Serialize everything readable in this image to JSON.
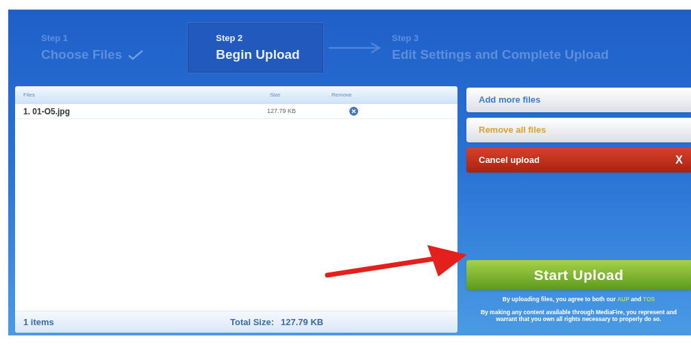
{
  "steps": [
    {
      "label": "Step 1",
      "title": "Choose Files",
      "done": true,
      "selected": false
    },
    {
      "label": "Step 2",
      "title": "Begin Upload",
      "done": false,
      "selected": true
    },
    {
      "label": "Step 3",
      "title": "Edit Settings and Complete Upload",
      "done": false,
      "selected": false
    }
  ],
  "files": {
    "columns": [
      "Files",
      "Size",
      "Remove"
    ],
    "rows": [
      {
        "name": "1. 01-O5.jpg",
        "size": "127.79 KB"
      }
    ],
    "footer": {
      "count": "1 items",
      "total_label": "Total Size:",
      "total": "127.79 KB"
    }
  },
  "actions": [
    {
      "label": "Add more files",
      "kind": "add"
    },
    {
      "label": "Remove all files",
      "kind": "remove"
    },
    {
      "label": "Cancel upload",
      "kind": "cancel",
      "close": "X"
    }
  ],
  "start_button": "Start Upload",
  "agreement": {
    "text": "By uploading files, you agree to both our",
    "links": [
      "AUP",
      "TOS"
    ],
    "joiner": "and"
  },
  "notice": "By making any content available through MediaFire, you represent and warrant that you own all rights necessary to properly do so.",
  "annotation": {
    "kind": "arrow"
  }
}
